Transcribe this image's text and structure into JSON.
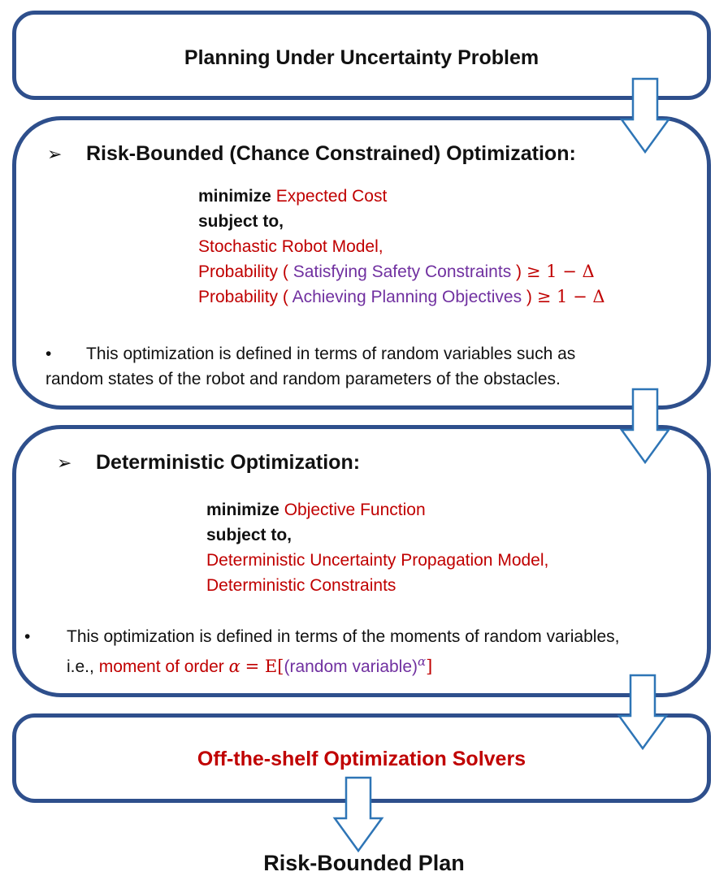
{
  "top_box": {
    "title": "Planning Under Uncertainty Problem"
  },
  "risk_box": {
    "heading_marker": "➢",
    "heading": "Risk-Bounded (Chance Constrained) Optimization:",
    "minimize_keyword": "minimize",
    "objective": "Expected Cost",
    "subject_to": "subject to,",
    "constraint_1": "Stochastic Robot Model,",
    "constraint_2": {
      "prefix": "Probability (",
      "inner": "Satisfying Safety Constraints",
      "suffix": ")",
      "bound": "≥ 1 − Δ"
    },
    "constraint_3": {
      "prefix": "Probability (",
      "inner": "Achieving Planning Objectives",
      "suffix": ")",
      "bound": "≥ 1 − Δ"
    },
    "note_bullet": "•",
    "note_line_1": "This optimization is defined in terms of random variables such as",
    "note_line_2": "random states of the robot and random parameters of the obstacles."
  },
  "det_box": {
    "heading_marker": "➢",
    "heading": "Deterministic Optimization:",
    "minimize_keyword": "minimize",
    "objective": "Objective Function",
    "subject_to": "subject to,",
    "constraint_1": "Deterministic Uncertainty Propagation Model,",
    "constraint_2": "Deterministic Constraints",
    "note_bullet": "•",
    "note_line_1": "This optimization is defined in terms of the moments of random variables,",
    "note_line_2_prefix": "i.e.,",
    "note_moment": "moment of order",
    "note_alpha": "α",
    "note_equals": "= E[",
    "note_random_variable": "(random variable)",
    "note_exponent": "α",
    "note_close": "]"
  },
  "solver_box": {
    "title": "Off-the-shelf Optimization Solvers"
  },
  "output": {
    "label": "Risk-Bounded Plan"
  },
  "colors": {
    "border": "#2e4f8c",
    "arrow": "#2e75b6",
    "red_text": "#c00000",
    "purple_text": "#7030a0"
  }
}
